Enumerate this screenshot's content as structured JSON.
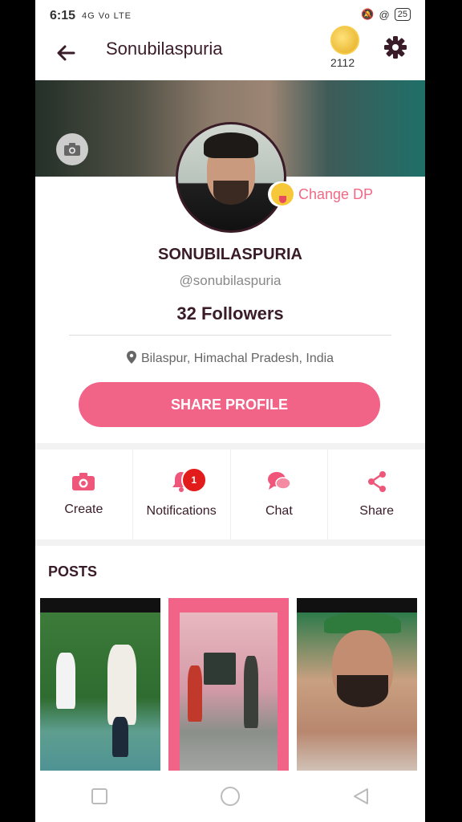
{
  "status_bar": {
    "time": "6:15",
    "signal_text": "4G Vo LTE",
    "battery": "25"
  },
  "header": {
    "title": "Sonubilaspuria",
    "coins": "2112"
  },
  "profile": {
    "display_name": "SONUBILASPURIA",
    "handle": "@sonubilaspuria",
    "followers": "32 Followers",
    "location": "Bilaspur, Himachal Pradesh, India",
    "change_dp_label": "Change DP",
    "share_button": "SHARE PROFILE"
  },
  "actions": [
    {
      "label": "Create",
      "icon": "camera-icon"
    },
    {
      "label": "Notifications",
      "icon": "bell-icon",
      "badge": "1"
    },
    {
      "label": "Chat",
      "icon": "chat-icon"
    },
    {
      "label": "Share",
      "icon": "share-icon"
    }
  ],
  "posts": {
    "title": "POSTS",
    "items": [
      {
        "type": "video"
      },
      {
        "type": "video"
      },
      {
        "type": "video"
      }
    ]
  },
  "colors": {
    "accent": "#f26487",
    "text_dark": "#3a1c28",
    "badge": "#e21b1b"
  }
}
